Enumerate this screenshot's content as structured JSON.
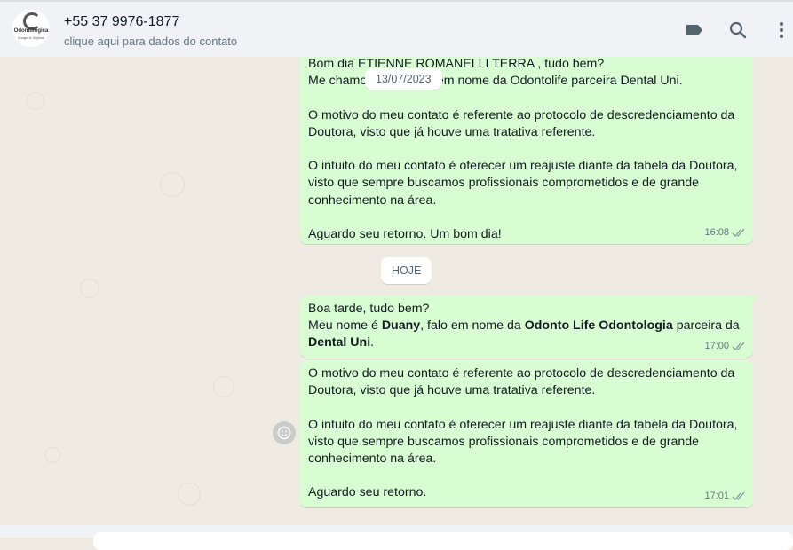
{
  "header": {
    "avatar_logo_text": "Odontológica",
    "avatar_logo_sub": "Imagens Digitais",
    "contact_name": "+55 37 9976-1877",
    "contact_subtitle": "clique aqui para dados do contato",
    "icons": [
      "label-icon",
      "search-icon",
      "more-vertical-icon"
    ]
  },
  "chat": {
    "date_pill_1": "13/07/2023",
    "date_pill_2": "HOJE",
    "messages": [
      {
        "lines": [
          "Bom dia ETIENNE ROMANELLI TERRA , tudo bem?",
          "Me chamo Duany, falo em nome da Odontolife parceira Dental Uni.",
          "",
          "O motivo do meu contato é referente ao protocolo de descredenciamento da",
          "Doutora, visto que já houve uma tratativa referente.",
          "",
          "O intuito do meu contato é oferecer um reajuste diante da tabela da Doutora,",
          "visto que sempre buscamos profissionais comprometidos e de grande",
          "conhecimento na área.",
          "",
          "Aguardo seu retorno. Um bom dia!"
        ],
        "time": "16:08"
      },
      {
        "greeting": "Boa tarde, tudo bem?",
        "line2_pre": "Meu nome é ",
        "line2_name": "Duany",
        "line2_mid": ", falo em nome da ",
        "line2_company": "Odonto Life Odontologia",
        "line2_post": " parceira da",
        "line3_bold": "Dental Uni",
        "line3_post": ".",
        "time": "17:00"
      },
      {
        "lines": [
          "O motivo do meu contato é referente ao protocolo de descredenciamento da",
          "Doutora, visto que já houve uma tratativa referente.",
          "",
          "O intuito do meu contato é oferecer um reajuste diante da tabela da Doutora,",
          "visto que sempre buscamos profissionais comprometidos e de grande",
          "conhecimento na área.",
          "",
          "Aguardo seu retorno."
        ],
        "time": "17:01"
      }
    ]
  },
  "colors": {
    "outgoing_bubble": "#d9fdd3",
    "chat_background": "#efeae2",
    "header_background": "#f0f2f5",
    "tick_color": "#8696a0"
  }
}
